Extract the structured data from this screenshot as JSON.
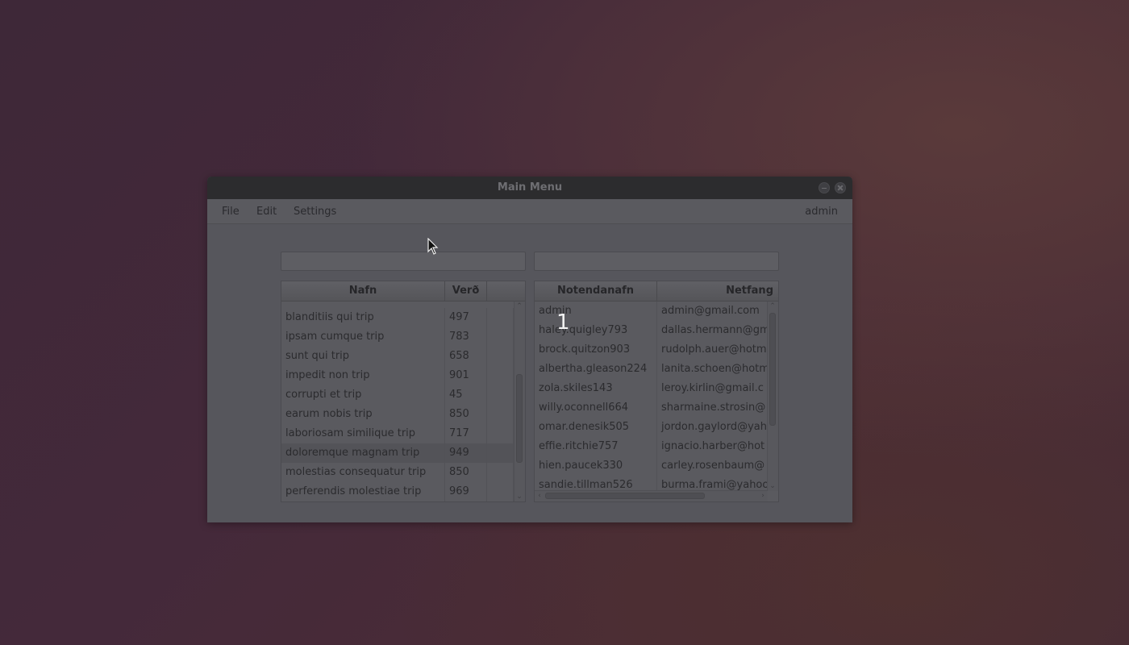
{
  "window": {
    "title": "Main Menu"
  },
  "menubar": {
    "items": [
      "File",
      "Edit",
      "Settings"
    ],
    "user": "admin"
  },
  "search": {
    "left_value": "",
    "right_value": ""
  },
  "trips_table": {
    "headers": [
      "Nafn",
      "Verð"
    ],
    "rows": [
      {
        "name": "blanditiis qui trip",
        "price": "497"
      },
      {
        "name": "ipsam cumque trip",
        "price": "783"
      },
      {
        "name": "sunt qui trip",
        "price": "658"
      },
      {
        "name": "impedit non trip",
        "price": "901"
      },
      {
        "name": "corrupti et trip",
        "price": "45"
      },
      {
        "name": "earum nobis trip",
        "price": "850"
      },
      {
        "name": "laboriosam similique trip",
        "price": "717"
      },
      {
        "name": "doloremque magnam trip",
        "price": "949"
      },
      {
        "name": "molestias consequatur trip",
        "price": "850"
      },
      {
        "name": "perferendis molestiae trip",
        "price": "969"
      }
    ],
    "selected_index": 7
  },
  "users_table": {
    "headers": [
      "Notendanafn",
      "Netfang"
    ],
    "rows": [
      {
        "username": "admin",
        "email": "admin@gmail.com"
      },
      {
        "username": "haley.quigley793",
        "email": "dallas.hermann@gm"
      },
      {
        "username": "brock.quitzon903",
        "email": "rudolph.auer@hotm"
      },
      {
        "username": "albertha.gleason224",
        "email": "lanita.schoen@hotm"
      },
      {
        "username": "zola.skiles143",
        "email": "leroy.kirlin@gmail.c"
      },
      {
        "username": "willy.oconnell664",
        "email": "sharmaine.strosin@"
      },
      {
        "username": "omar.denesik505",
        "email": "jordon.gaylord@yah"
      },
      {
        "username": "effie.ritchie757",
        "email": "ignacio.harber@hot"
      },
      {
        "username": "hien.paucek330",
        "email": "carley.rosenbaum@"
      },
      {
        "username": "sandie.tillman526",
        "email": "burma.frami@yahoo"
      }
    ]
  },
  "overlay": {
    "step_number": "1"
  },
  "icons": {
    "close": "close-icon",
    "minimize": "minimize-icon",
    "cursor": "mouse-pointer-icon"
  }
}
